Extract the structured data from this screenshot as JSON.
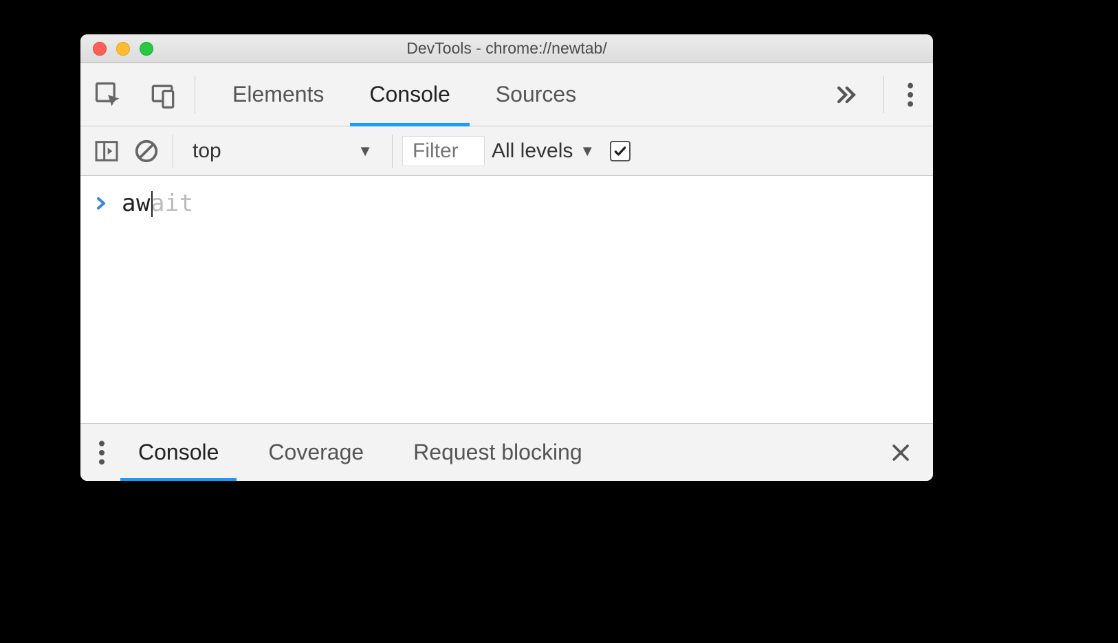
{
  "window": {
    "title": "DevTools - chrome://newtab/"
  },
  "tabs": {
    "elements": "Elements",
    "console": "Console",
    "sources": "Sources"
  },
  "consoleToolbar": {
    "context": "top",
    "filterPlaceholder": "Filter",
    "levels": "All levels"
  },
  "consoleInput": {
    "typed": "aw",
    "ghost": "ait"
  },
  "drawer": {
    "console": "Console",
    "coverage": "Coverage",
    "requestBlocking": "Request blocking"
  }
}
